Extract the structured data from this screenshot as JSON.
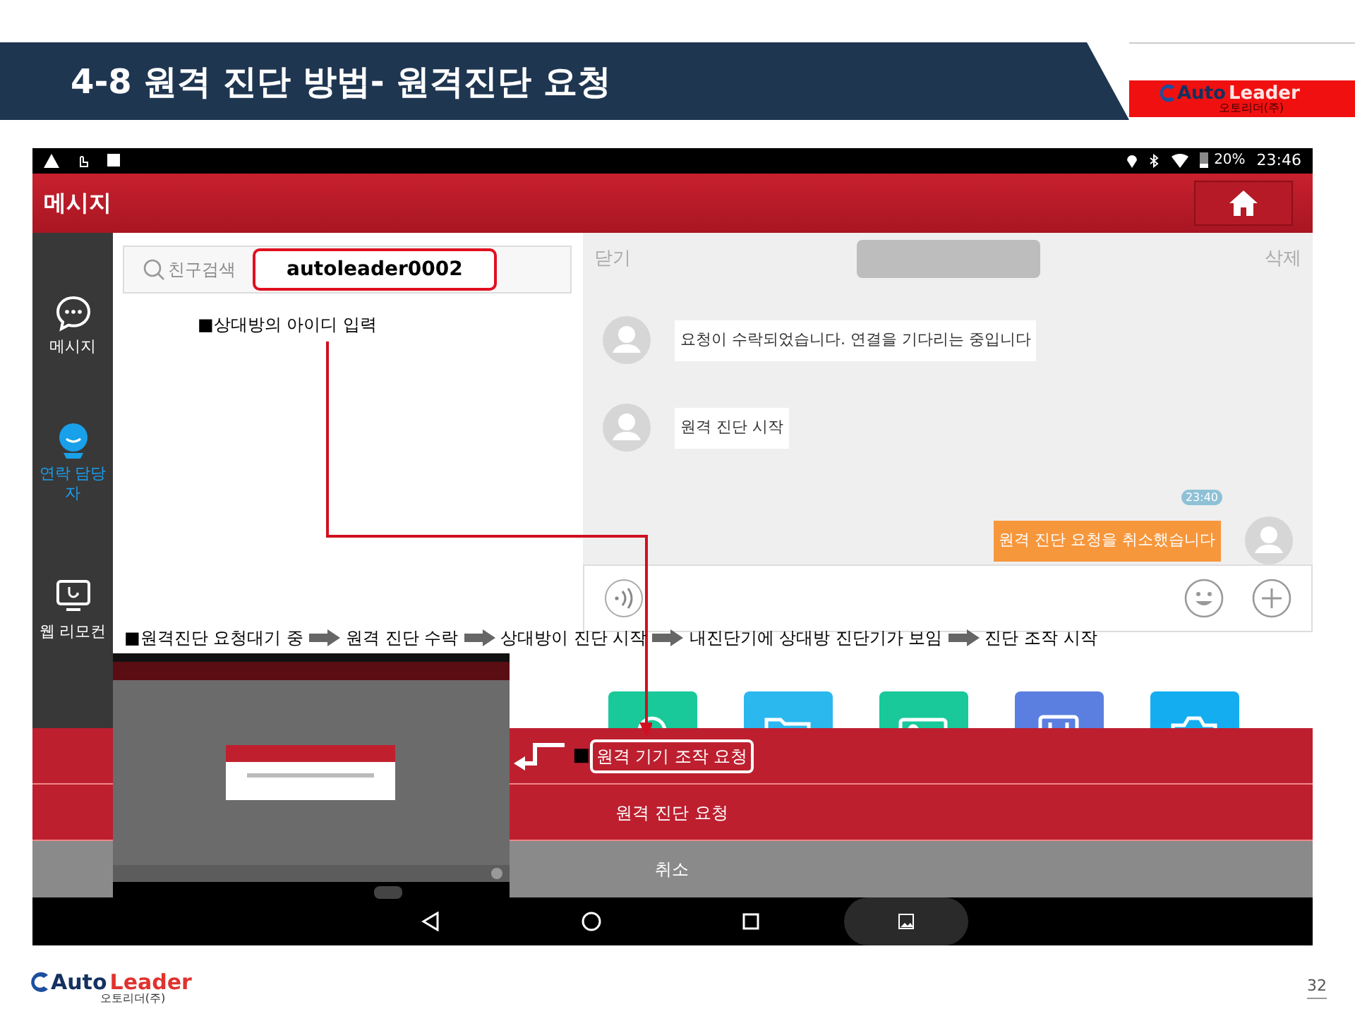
{
  "slide": {
    "title": "4-8 원격 진단 방법- 원격진단 요청",
    "page_number": "32"
  },
  "header_logo": {
    "brand_left": "Auto",
    "brand_right": "Leader",
    "subtitle": "오토리더(주)"
  },
  "footer_logo": {
    "brand_left": "Auto",
    "brand_right": "Leader",
    "subtitle": "오토리더(주)"
  },
  "status_bar": {
    "battery": "20%",
    "time": "23:46"
  },
  "app_bar": {
    "title": "메시지"
  },
  "sidebar": [
    {
      "label": "메시지",
      "kind": "chat",
      "selected": false
    },
    {
      "label": "연락 담당 자",
      "kind": "contact",
      "selected": true
    },
    {
      "label": "웹 리모컨",
      "kind": "remote",
      "selected": false
    }
  ],
  "search": {
    "placeholder": "친구검색"
  },
  "chat": {
    "close": "닫기",
    "delete": "삭제",
    "messages": [
      {
        "kind": "incoming",
        "text": "요청이 수락되었습니다. 연결을 기다리는 중입니다"
      },
      {
        "kind": "incoming",
        "text": "원격 진단 시작"
      },
      {
        "kind": "timestamp",
        "text": "23:40"
      },
      {
        "kind": "outgoing",
        "text": "원격 진단 요청을 취소했습니다"
      }
    ]
  },
  "app_tiles": [
    {
      "kind": "search",
      "color": "#19c99a"
    },
    {
      "kind": "folder",
      "color": "#2bb8ef"
    },
    {
      "kind": "photo",
      "color": "#19c99a"
    },
    {
      "kind": "circuit",
      "color": "#5b7fe0"
    },
    {
      "kind": "camera",
      "color": "#14aef0"
    }
  ],
  "action_sheet": [
    {
      "label": "원격 기기 조작 요청",
      "kind": "action",
      "highlighted": true
    },
    {
      "label": "원격 진단 요청",
      "kind": "action",
      "highlighted": false
    },
    {
      "label": "취소",
      "kind": "cancel",
      "highlighted": false
    }
  ],
  "annotations": {
    "typed_id": "autoleader0002",
    "id_note": "■상대방의 아이디 입력",
    "sheet_marker": "■",
    "steps": [
      "■원격진단 요청대기 중",
      "원격 진단 수락",
      "상대방이 진단 시작",
      "내진단기에 상대방 진단기가 보임",
      "진단 조작 시작"
    ]
  }
}
